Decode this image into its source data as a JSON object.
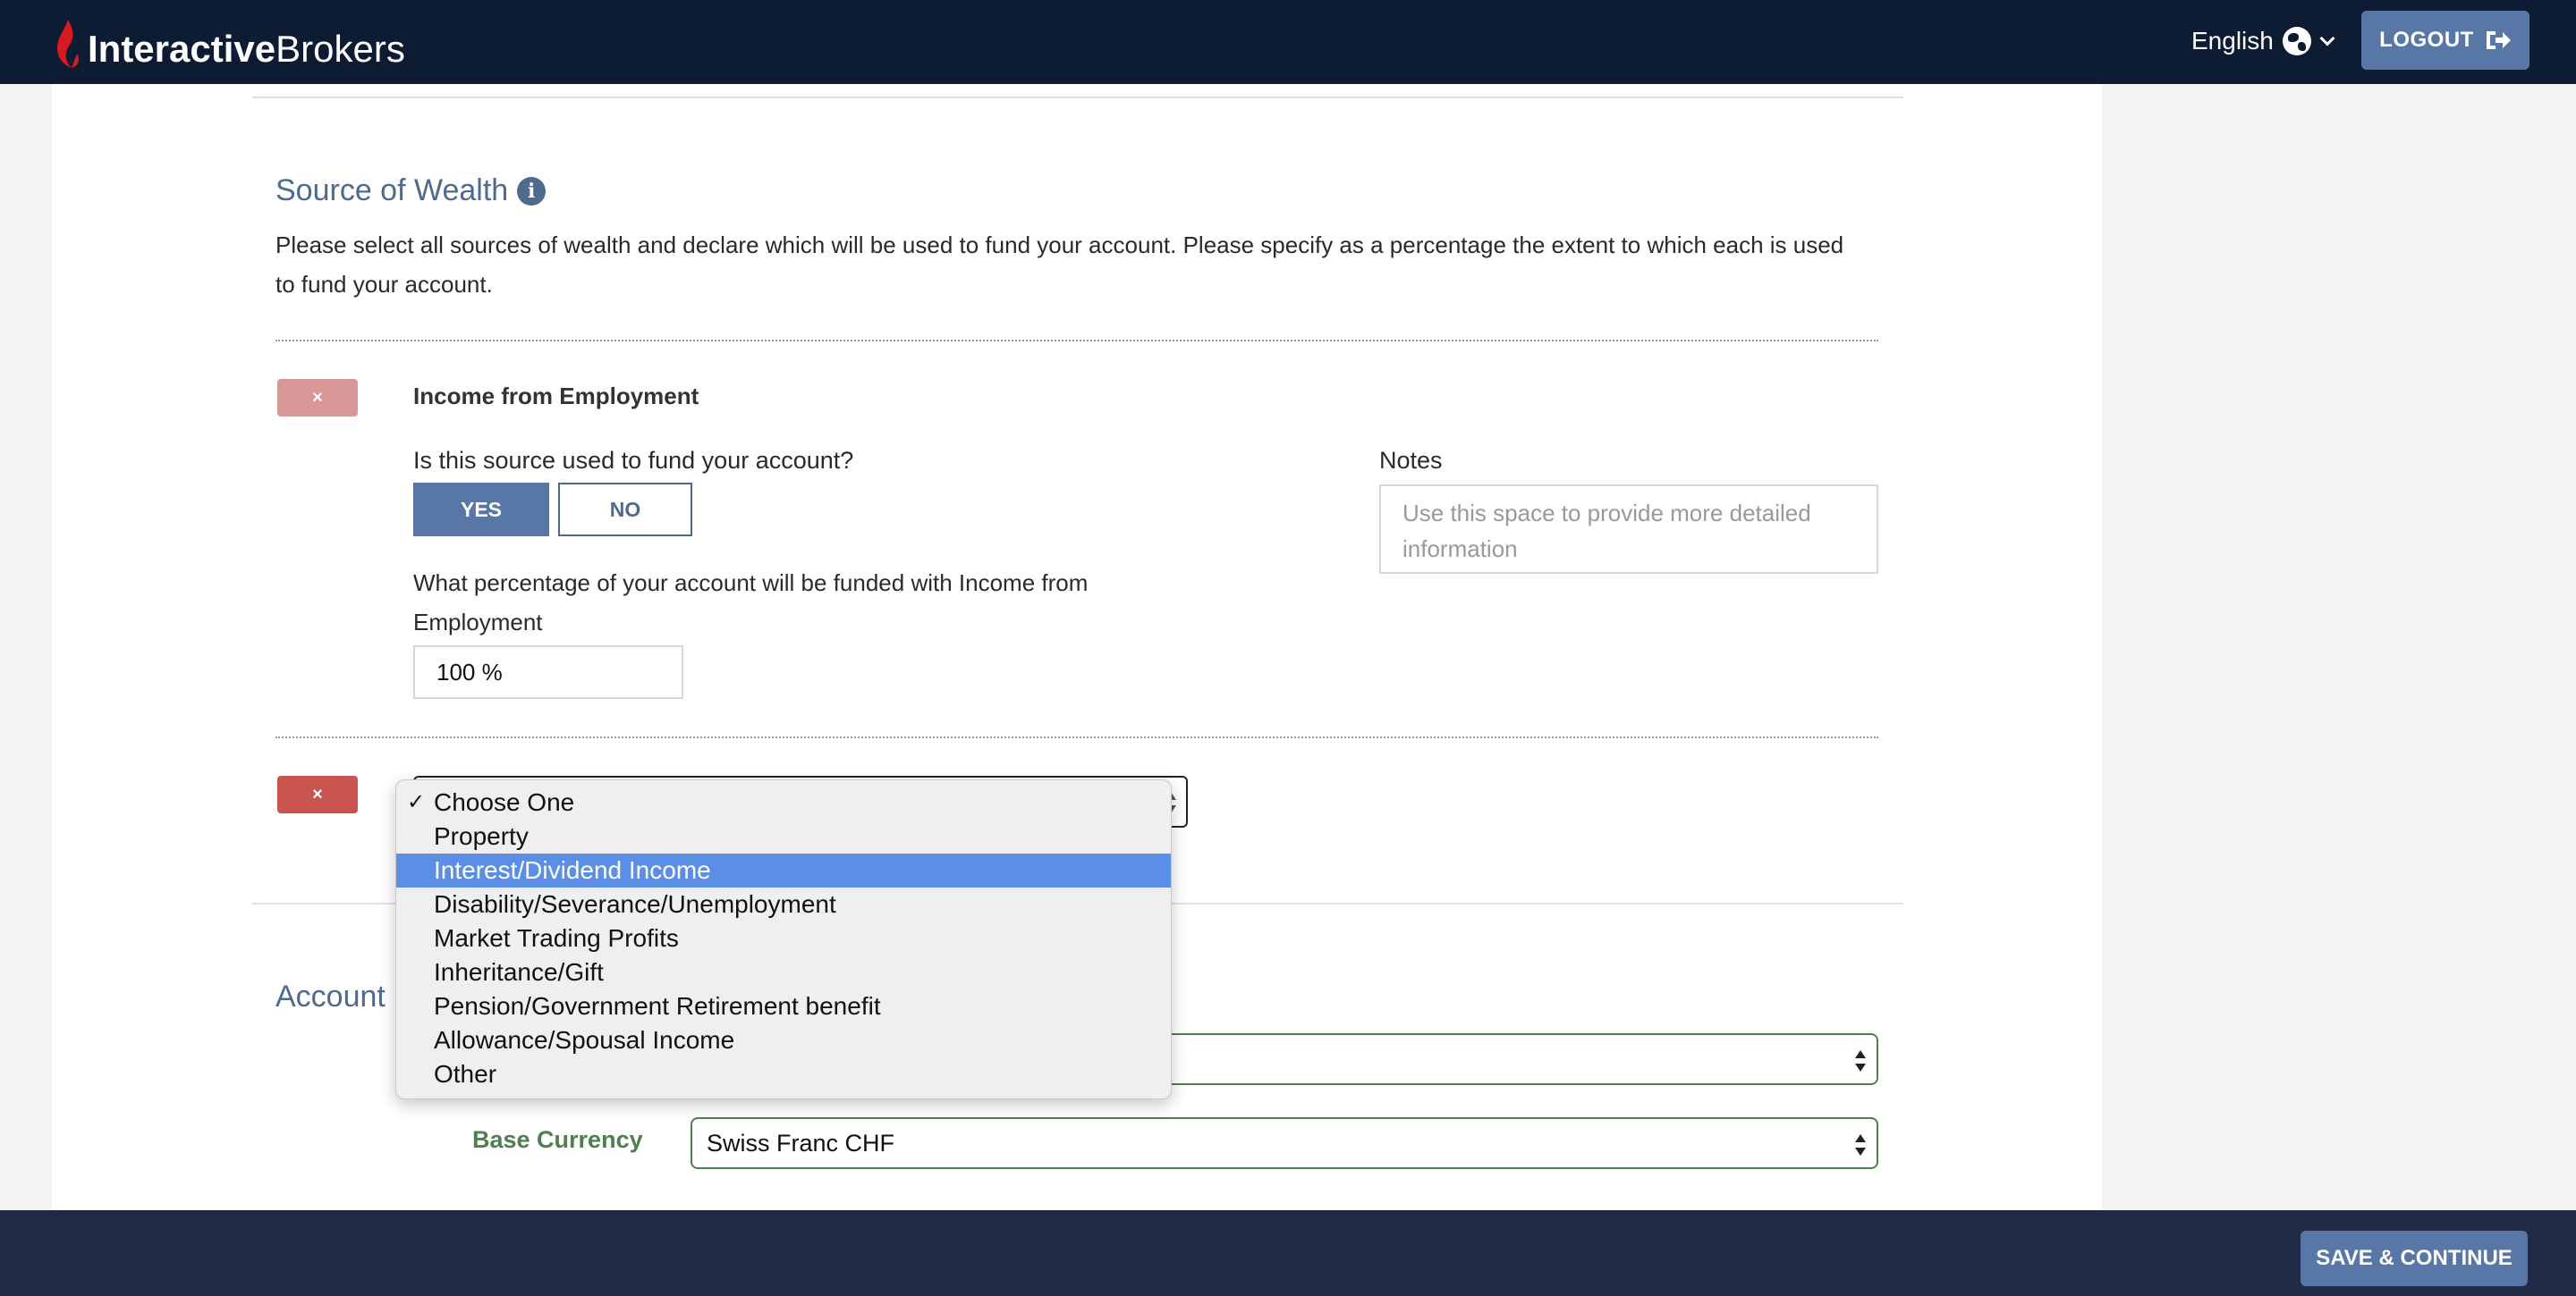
{
  "header": {
    "logo_bold": "Interactive",
    "logo_light": "Brokers",
    "language": "English",
    "logout_label": "LOGOUT"
  },
  "source_of_wealth": {
    "title": "Source of Wealth",
    "description": "Please select all sources of wealth and declare which will be used to fund your account. Please specify as a percentage the extent to which each is used to fund your account.",
    "remove_label": "×",
    "entry": {
      "title": "Income from Employment",
      "question": "Is this source used to fund your account?",
      "yes_label": "YES",
      "no_label": "NO",
      "percentage_label": "What percentage of your account will be funded with Income from Employment",
      "percentage_value": "100 %",
      "notes_label": "Notes",
      "notes_placeholder": "Use this space to provide more detailed information"
    },
    "dropdown": {
      "options": [
        "Choose One",
        "Property",
        "Interest/Dividend Income",
        "Disability/Severance/Unemployment",
        "Market Trading Profits",
        "Inheritance/Gift",
        "Pension/Government Retirement benefit",
        "Allowance/Spousal Income",
        "Other"
      ],
      "checked": "Choose One",
      "highlighted": "Interest/Dividend Income"
    }
  },
  "account": {
    "title_visible": "Account",
    "base_currency_label": "Base Currency",
    "base_currency_value": "Swiss Franc CHF"
  },
  "footer": {
    "save_label": "SAVE & CONTINUE"
  },
  "colors": {
    "header_bg": "#0d1b33",
    "accent": "#5877a6",
    "remove_red": "#c9534f",
    "green_border": "#4f7f4f",
    "highlight": "#5b8ee6"
  }
}
